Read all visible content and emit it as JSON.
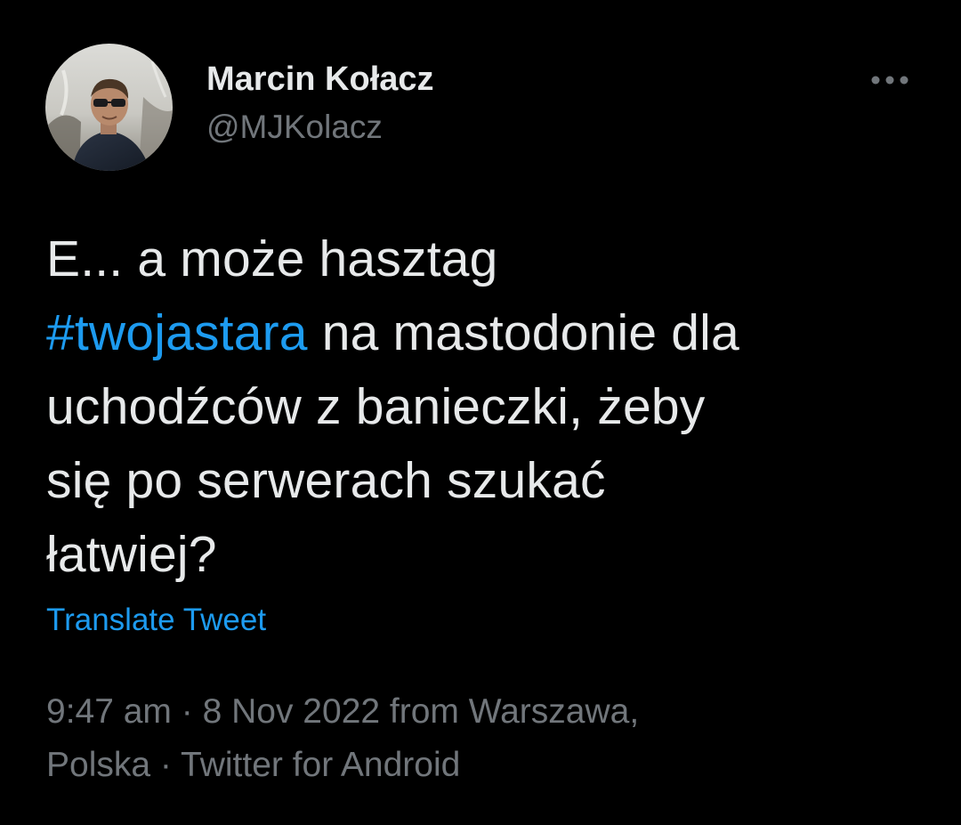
{
  "author": {
    "display_name": "Marcin Kołacz",
    "handle": "@MJKolacz",
    "avatar_icon": "user-avatar-photo"
  },
  "more_icon": "more-horizontal-icon",
  "tweet": {
    "line1": "E... a może hasztag",
    "hashtag": "#twojastara",
    "line2_rest": " na mastodonie dla",
    "line3": "uchodźców z banieczki, żeby",
    "line4": "się po serwerach szukać",
    "line5": "łatwiej?"
  },
  "translate_label": "Translate Tweet",
  "meta": {
    "time": "9:47 am",
    "sep1": " · ",
    "date": "8 Nov 2022",
    "from_text": " from Warszawa,",
    "location_cont": "Polska",
    "sep2": " · ",
    "source": "Twitter for Android"
  },
  "colors": {
    "background": "#000000",
    "text_primary": "#e7e9ea",
    "text_secondary": "#71767b",
    "accent": "#1d9bf0"
  }
}
